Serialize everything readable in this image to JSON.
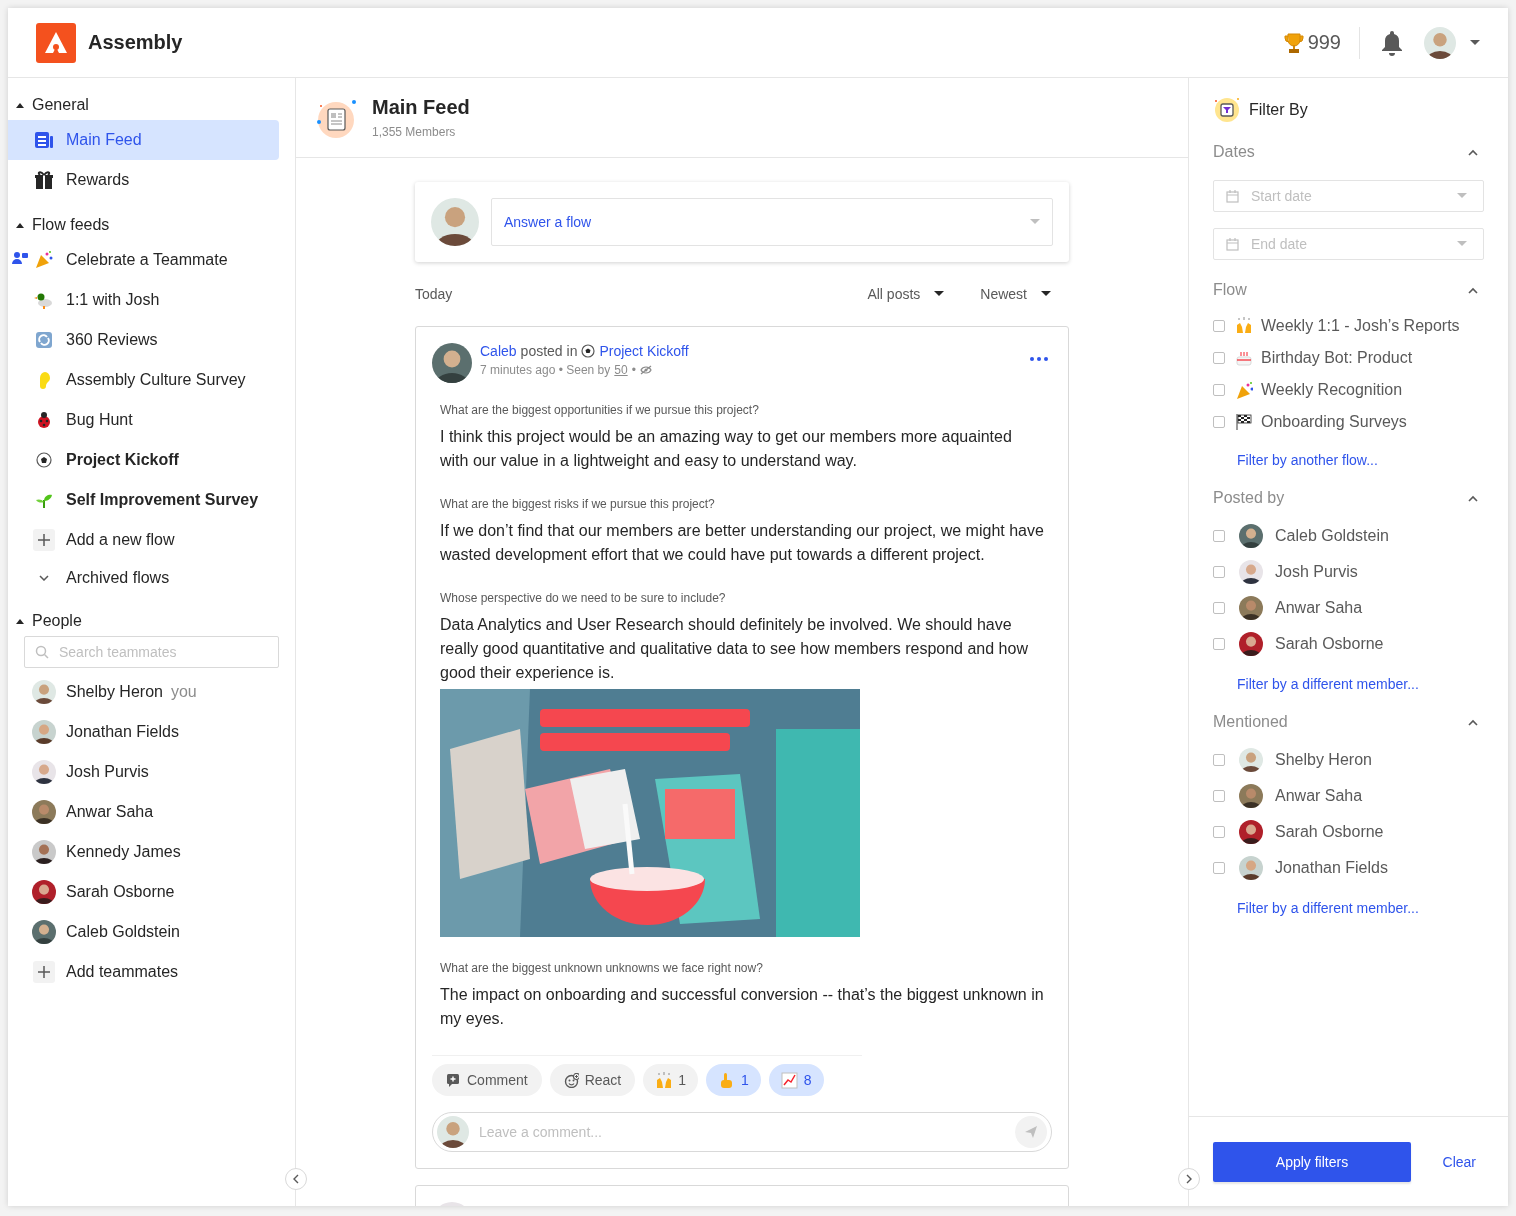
{
  "header": {
    "brand": "Assembly",
    "points": "999"
  },
  "sidebar": {
    "sections": [
      {
        "kind": "nav",
        "title": "General",
        "expanded": true,
        "items": [
          {
            "label": "Main Feed",
            "selected": true,
            "unread": false
          },
          {
            "label": "Rewards",
            "selected": false,
            "unread": false
          }
        ]
      },
      {
        "kind": "flows",
        "title": "Flow feeds",
        "expanded": true,
        "items": [
          {
            "label": "Celebrate a Teammate",
            "selected": false,
            "unread": false,
            "participant": true
          },
          {
            "label": "1:1 with Josh",
            "selected": false,
            "unread": false,
            "participant": false
          },
          {
            "label": "360 Reviews",
            "selected": false,
            "unread": false,
            "participant": false
          },
          {
            "label": "Assembly Culture Survey",
            "selected": false,
            "unread": false,
            "participant": false
          },
          {
            "label": "Bug Hunt",
            "selected": false,
            "unread": false,
            "participant": false
          },
          {
            "label": "Project Kickoff",
            "selected": false,
            "unread": true,
            "participant": false
          },
          {
            "label": "Self Improvement Survey",
            "selected": false,
            "unread": true,
            "participant": false
          }
        ],
        "add": "Add a new flow",
        "archived": "Archived flows"
      },
      {
        "kind": "people",
        "title": "People",
        "expanded": true,
        "search": {
          "placeholder": "Search teammates"
        },
        "members": [
          {
            "name": "Shelby Heron",
            "note": "you"
          },
          {
            "name": "Jonathan Fields"
          },
          {
            "name": "Josh Purvis"
          },
          {
            "name": "Anwar Saha"
          },
          {
            "name": "Kennedy James"
          },
          {
            "name": "Sarah Osborne"
          },
          {
            "name": "Caleb Goldstein"
          }
        ],
        "add": "Add teammates"
      }
    ]
  },
  "feed": {
    "title": "Main Feed",
    "members": "1,355 Members",
    "composer": {
      "value": "Answer a flow"
    },
    "day": "Today",
    "filters": [
      "All posts",
      "Newest"
    ],
    "post": {
      "author": "Caleb",
      "posted_in": "posted in",
      "flow": "Project Kickoff",
      "time": "7 minutes ago • Seen by",
      "seen": "50",
      "sep": "•",
      "blocks": [
        {
          "kind": "answer",
          "question": "What are the biggest opportunities if we pursue this project?",
          "answer": "I think this project would be an amazing way to get our members more aquainted with our value in a lightweight and easy to understand way."
        },
        {
          "kind": "answer",
          "question": "What are the biggest risks if we pursue this project?",
          "answer": "If we don’t find that our members are better understanding our project, we might have wasted development effort that we could have put towards a different project."
        },
        {
          "kind": "answer",
          "question": "Whose perspective do we need to be sure to include?",
          "answer": "Data Analytics and User Research should definitely be involved. We should have really good quantitative and qualitative data to see how members respond and how good their experience is."
        },
        {
          "kind": "picture"
        },
        {
          "kind": "answer",
          "question": "What are the biggest unknown unknowns we face right now?",
          "answer": "The impact on onboarding and successful conversion -- that’s the biggest unknown in my eyes."
        }
      ],
      "actions": [
        "Comment",
        "React"
      ],
      "reactions": [
        {
          "count": "1",
          "selected": false
        },
        {
          "count": "1",
          "selected": true
        },
        {
          "count": "8",
          "selected": true
        }
      ],
      "comment": {
        "placeholder": "Leave a comment..."
      }
    }
  },
  "filters": {
    "title": "Filter By",
    "sections": [
      {
        "kind": "dates",
        "title": "Dates",
        "expanded": true,
        "fields": [
          {
            "placeholder": "Start date"
          },
          {
            "placeholder": "End date"
          }
        ]
      },
      {
        "kind": "flows",
        "title": "Flow",
        "expanded": true,
        "options": [
          {
            "label": "Weekly 1:1 - Josh’s Reports",
            "checked": false
          },
          {
            "label": "Birthday Bot: Product",
            "checked": false
          },
          {
            "label": "Weekly Recognition",
            "checked": false
          },
          {
            "label": "Onboarding Surveys",
            "checked": false
          }
        ],
        "link": "Filter by another flow..."
      },
      {
        "kind": "members",
        "title": "Posted by",
        "expanded": true,
        "options": [
          {
            "label": "Caleb Goldstein",
            "checked": false
          },
          {
            "label": "Josh Purvis",
            "checked": false
          },
          {
            "label": "Anwar Saha",
            "checked": false
          },
          {
            "label": "Sarah Osborne",
            "checked": false
          }
        ],
        "link": "Filter by a different member..."
      },
      {
        "kind": "members",
        "title": "Mentioned",
        "expanded": true,
        "options": [
          {
            "label": "Shelby Heron",
            "checked": false
          },
          {
            "label": "Anwar Saha",
            "checked": false
          },
          {
            "label": "Sarah Osborne",
            "checked": false
          },
          {
            "label": "Jonathan Fields",
            "checked": false
          }
        ],
        "link": "Filter by a different member..."
      }
    ],
    "apply": "Apply filters",
    "clear": "Clear"
  }
}
